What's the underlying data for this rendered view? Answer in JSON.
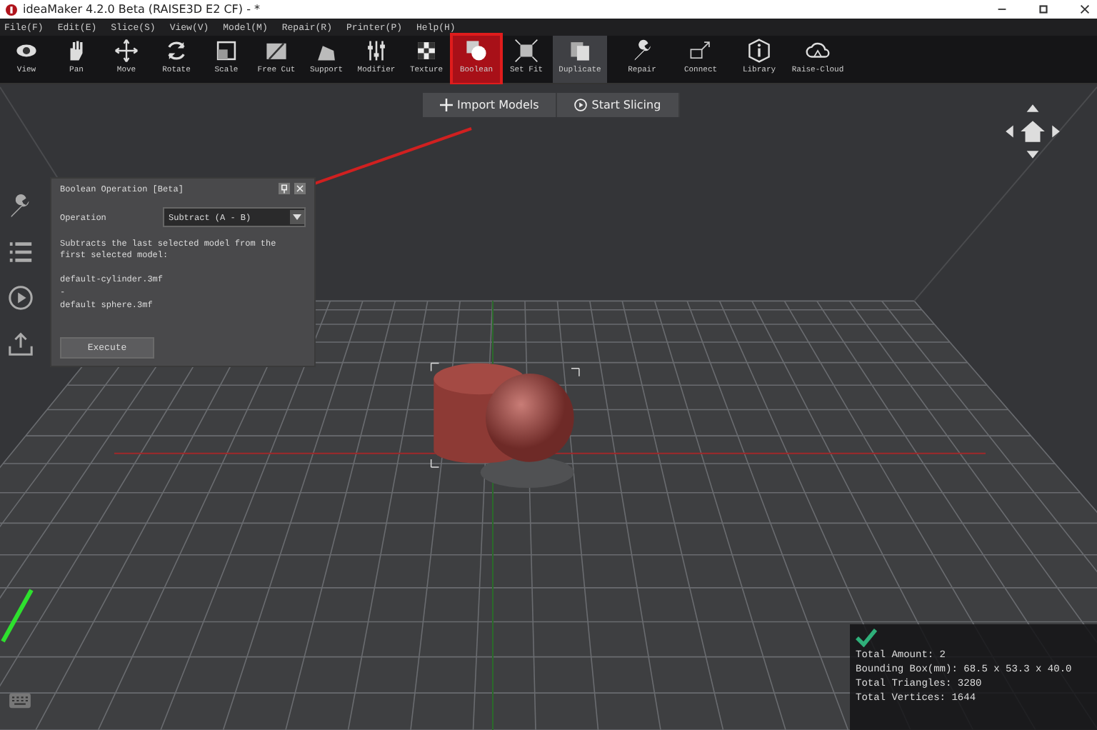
{
  "window": {
    "title": "ideaMaker 4.2.0 Beta (RAISE3D E2 CF) - *"
  },
  "menu": [
    "File(F)",
    "Edit(E)",
    "Slice(S)",
    "View(V)",
    "Model(M)",
    "Repair(R)",
    "Printer(P)",
    "Help(H)"
  ],
  "toolbar": [
    {
      "label": "View",
      "selected": false,
      "highlighted": false
    },
    {
      "label": "Pan",
      "selected": false,
      "highlighted": false
    },
    {
      "label": "Move",
      "selected": false,
      "highlighted": false
    },
    {
      "label": "Rotate",
      "selected": false,
      "highlighted": false
    },
    {
      "label": "Scale",
      "selected": false,
      "highlighted": false
    },
    {
      "label": "Free Cut",
      "selected": false,
      "highlighted": false
    },
    {
      "label": "Support",
      "selected": false,
      "highlighted": false
    },
    {
      "label": "Modifier",
      "selected": false,
      "highlighted": false
    },
    {
      "label": "Texture",
      "selected": false,
      "highlighted": false
    },
    {
      "label": "Boolean",
      "selected": true,
      "highlighted": false
    },
    {
      "label": "Set Fit",
      "selected": false,
      "highlighted": false
    },
    {
      "label": "Duplicate",
      "selected": false,
      "highlighted": true
    },
    {
      "label": "Repair",
      "selected": false,
      "highlighted": false
    },
    {
      "label": "Connect",
      "selected": false,
      "highlighted": false
    },
    {
      "label": "Library",
      "selected": false,
      "highlighted": false
    },
    {
      "label": "Raise-Cloud",
      "selected": false,
      "highlighted": false
    }
  ],
  "quick_actions": [
    "Import Models",
    "Start Slicing"
  ],
  "dialog": {
    "title": "Boolean Operation [Beta]",
    "operation_label": "Operation",
    "operation_value": "Subtract (A - B)",
    "description": "Subtracts the last selected model from the first selected model:",
    "models": [
      "default-cylinder.3mf",
      "-",
      "default sphere.3mf"
    ],
    "button": "Execute"
  },
  "info": {
    "ok": true,
    "lines": [
      "Total Amount: 2",
      "Bounding Box(mm): 68.5 x 53.3 x 40.0",
      "Total Triangles: 3280",
      "Total Vertices: 1644"
    ]
  }
}
